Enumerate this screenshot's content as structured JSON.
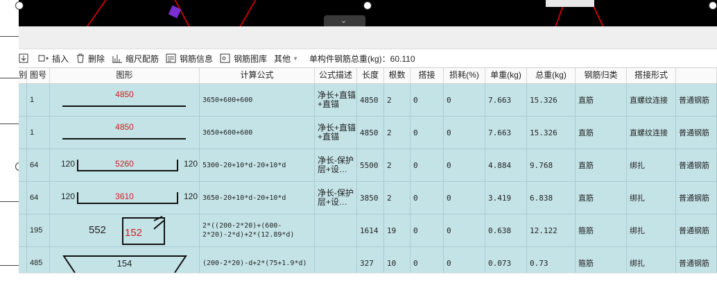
{
  "toolbar": {
    "insert": "插入",
    "delete": "删除",
    "scale_bars": "缩尺配筋",
    "rebar_info": "钢筋信息",
    "rebar_library": "钢筋图库",
    "other": "其他",
    "total_weight": "单构件钢筋总重(kg)：60.110"
  },
  "columns": {
    "cut": "别",
    "no": "图号",
    "shape": "图形",
    "formula": "计算公式",
    "desc": "公式描述",
    "len": "长度",
    "cnt": "根数",
    "lap": "搭接",
    "loss": "损耗(%)",
    "unit": "单重(kg)",
    "total": "总重(kg)",
    "cat": "钢筋归类",
    "lapform": "搭接形式"
  },
  "rows": [
    {
      "no": "1",
      "shape_main": "4850",
      "formula": "3650+600+600",
      "desc": "净长+直锚+直锚",
      "len": "4850",
      "cnt": "2",
      "lap": "0",
      "loss": "0",
      "unit": "7.663",
      "total": "15.326",
      "cat": "直筋",
      "lapform": "直螺纹连接",
      "type": "普通钢筋"
    },
    {
      "no": "1",
      "shape_main": "4850",
      "formula": "3650+600+600",
      "desc": "净长+直锚+直锚",
      "len": "4850",
      "cnt": "2",
      "lap": "0",
      "loss": "0",
      "unit": "7.663",
      "total": "15.326",
      "cat": "直筋",
      "lapform": "直螺纹连接",
      "type": "普通钢筋"
    },
    {
      "no": "64",
      "shape_left": "120",
      "shape_main": "5260",
      "shape_right": "120",
      "formula": "5300-20+10*d-20+10*d",
      "desc": "净长-保护层+设…",
      "len": "5500",
      "cnt": "2",
      "lap": "0",
      "loss": "0",
      "unit": "4.884",
      "total": "9.768",
      "cat": "直筋",
      "lapform": "绑扎",
      "type": "普通钢筋"
    },
    {
      "no": "64",
      "shape_left": "120",
      "shape_main": "3610",
      "shape_right": "120",
      "formula": "3650-20+10*d-20+10*d",
      "desc": "净长-保护层+设…",
      "len": "3850",
      "cnt": "2",
      "lap": "0",
      "loss": "0",
      "unit": "3.419",
      "total": "6.838",
      "cat": "直筋",
      "lapform": "绑扎",
      "type": "普通钢筋"
    },
    {
      "no": "195",
      "shape_left": "552",
      "shape_main": "152",
      "formula": "2*((200-2*20)+(600-2*20)-2*d)+2*(12.89*d)",
      "desc": "",
      "len": "1614",
      "cnt": "19",
      "lap": "0",
      "loss": "0",
      "unit": "0.638",
      "total": "12.122",
      "cat": "箍筋",
      "lapform": "绑扎",
      "type": "普通钢筋"
    },
    {
      "no": "485",
      "shape_main": "154",
      "formula": "(200-2*20)-d+2*(75+1.9*d)",
      "desc": "",
      "len": "327",
      "cnt": "10",
      "lap": "0",
      "loss": "0",
      "unit": "0.073",
      "total": "0.73",
      "cat": "箍筋",
      "lapform": "绑扎",
      "type": "普通钢筋"
    }
  ]
}
